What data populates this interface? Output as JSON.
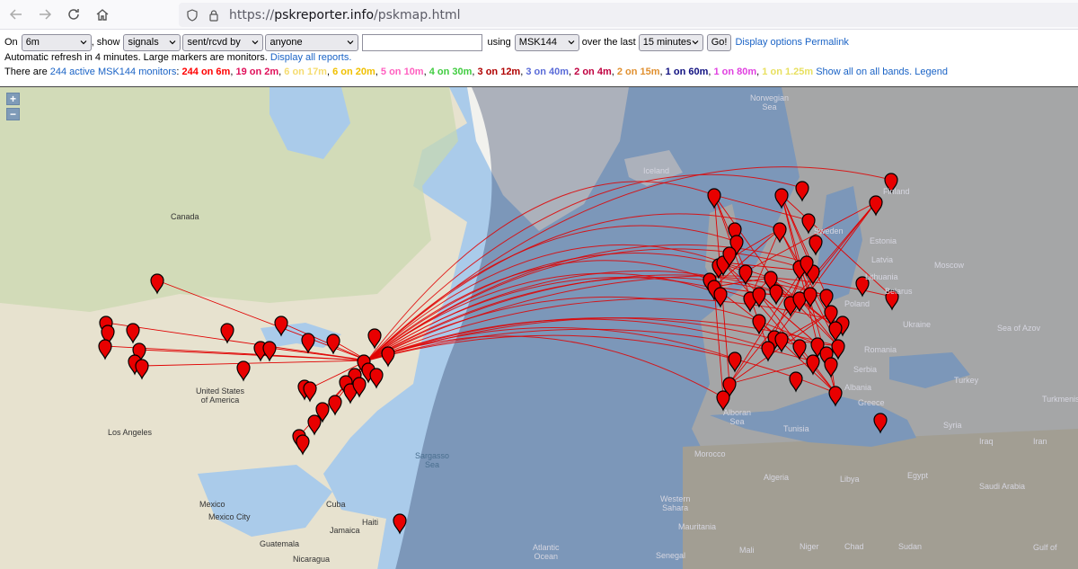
{
  "browser": {
    "url_prefix": "https://",
    "url_host": "pskreporter.info",
    "url_path": "/pskmap.html"
  },
  "controls": {
    "on_label": "On",
    "band_value": "6m",
    "show_label": ", show",
    "show_value": "signals",
    "direction_value": "sent/rcvd by",
    "who_value": "anyone",
    "callsign_value": "",
    "using_label": "using",
    "mode_value": "MSK144",
    "over_label": "over the last",
    "period_value": "15 minutes",
    "go_label": "Go!",
    "display_options": "Display options",
    "permalink": "Permalink",
    "refresh_text": "Automatic refresh in 4 minutes. Large markers are monitors.",
    "display_all": "Display all reports.",
    "there_are": "There are",
    "active_monitors": "244 active MSK144 monitors",
    "colon": ":",
    "bands": [
      {
        "text": "244 on 6m",
        "color": "#ff0000"
      },
      {
        "text": "19 on 2m",
        "color": "#e0105a"
      },
      {
        "text": "6 on 17m",
        "color": "#f5dc70"
      },
      {
        "text": "6 on 20m",
        "color": "#f0c000"
      },
      {
        "text": "5 on 10m",
        "color": "#ff60c0"
      },
      {
        "text": "4 on 30m",
        "color": "#40cc40"
      },
      {
        "text": "3 on 12m",
        "color": "#b00000"
      },
      {
        "text": "3 on 40m",
        "color": "#5a6bd8"
      },
      {
        "text": "2 on 4m",
        "color": "#c00040"
      },
      {
        "text": "2 on 15m",
        "color": "#e09030"
      },
      {
        "text": "1 on 60m",
        "color": "#101080"
      },
      {
        "text": "1 on 80m",
        "color": "#e040e0"
      },
      {
        "text": "1 on 1.25m",
        "color": "#e8e060"
      }
    ],
    "show_all": "Show all on all bands.",
    "legend": "Legend"
  },
  "map": {
    "zoom_in": "+",
    "zoom_out": "−",
    "labels": {
      "norwegian_sea": "Norwegian\nSea",
      "iceland": "Iceland",
      "canada": "Canada",
      "finland": "Finland",
      "sweden": "Sweden",
      "estonia": "Estonia",
      "latvia": "Latvia",
      "lithuania": "Lithuania",
      "belarus": "Belarus",
      "moscow": "Moscow",
      "poland": "Poland",
      "ukraine": "Ukraine",
      "romania": "Romania",
      "sea_of_azov": "Sea of Azov",
      "serbia": "Serbia",
      "albania": "Albania",
      "greece": "Greece",
      "turkey": "Turkey",
      "turkmenistan": "Turkmenis",
      "iraq": "Iraq",
      "syria": "Syria",
      "iran": "Iran",
      "saudi_arabia": "Saudi Arabia",
      "egypt": "Egypt",
      "libya": "Libya",
      "algeria": "Algeria",
      "tunisia": "Tunisia",
      "morocco": "Morocco",
      "mali": "Mali",
      "niger": "Niger",
      "chad": "Chad",
      "sudan": "Sudan",
      "western_sahara": "Western\nSahara",
      "mauritania": "Mauritania",
      "senegal": "Senegal",
      "gulf_of": "Gulf of",
      "alboran": "Alboran\nSea",
      "united_states": "United States\nof America",
      "los_angeles": "Los Angeles",
      "mexico": "Mexico",
      "mexico_city": "Mexico City",
      "cuba": "Cuba",
      "haiti": "Haiti",
      "jamaica": "Jamaica",
      "guatemala": "Guatemala",
      "nicaragua": "Nicaragua",
      "sargasso": "Sargasso\nSea",
      "atlantic": "Atlantic\nOcean"
    }
  }
}
